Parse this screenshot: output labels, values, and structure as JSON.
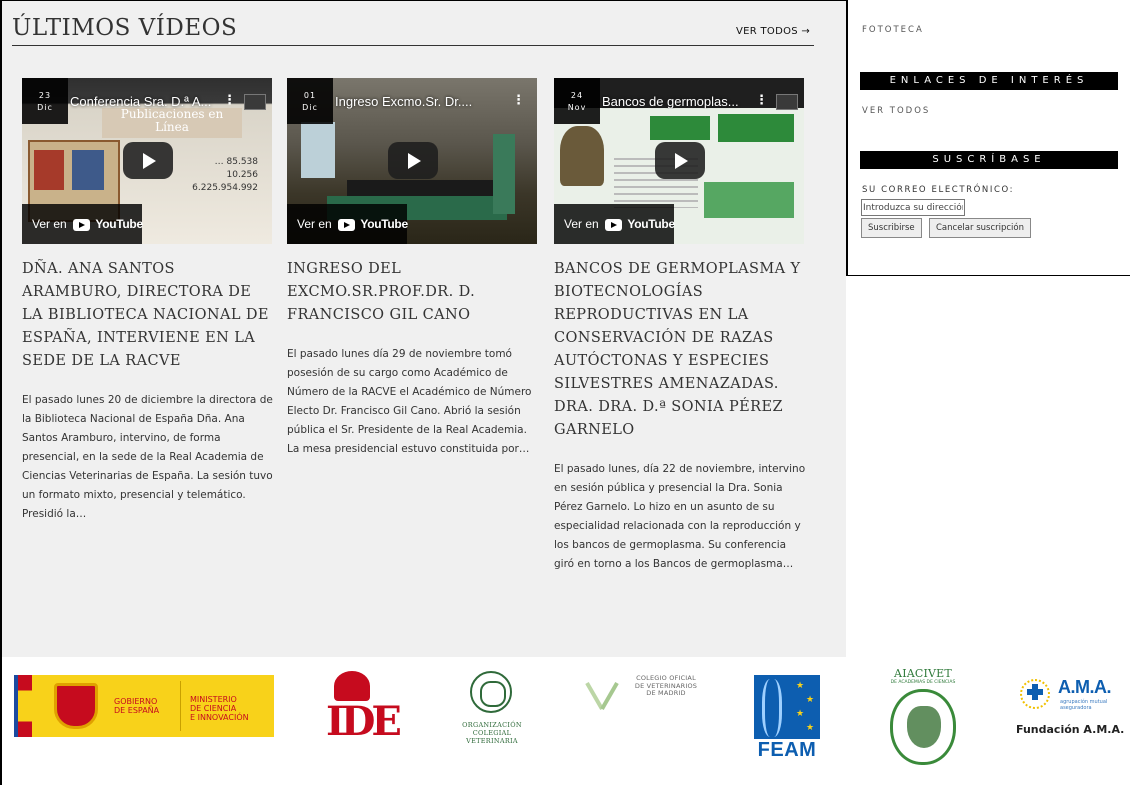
{
  "main": {
    "section_title": "ÚLTIMOS VÍDEOS",
    "see_all": "VER TODOS →",
    "cards": [
      {
        "date_day": "23",
        "date_month": "Dic",
        "video_title": "Conferencia Sra. D.ª A...",
        "yt_watch": "Ver en",
        "yt_brand": "YouTube",
        "title": "DÑA. ANA SANTOS ARAMBURO, DIRECTORA DE LA BIBLIOTECA NACIONAL DE ESPAÑA, INTERVIENE EN LA SEDE DE LA RACVE",
        "excerpt": "El pasado lunes 20 de diciembre la directora de la Biblioteca Nacional de España Dña. Ana Santos Aramburo, intervino, de forma presencial, en la sede de la Real Academia de Ciencias Veterinarias de España. La sesión tuvo un formato mixto, presencial y telemático. Presidió la…",
        "thumb_heading": "Publicaciones en Línea",
        "thumb_numbers": [
          "… 85.538",
          "10.256",
          "6.225.954.992"
        ]
      },
      {
        "date_day": "01",
        "date_month": "Dic",
        "video_title": "Ingreso Excmo.Sr. Dr....",
        "yt_watch": "Ver en",
        "yt_brand": "YouTube",
        "title": "INGRESO DEL EXCMO.SR.PROF.DR. D. FRANCISCO GIL CANO",
        "excerpt": "El pasado lunes día 29 de noviembre tomó posesión de su cargo como Académico de Número de la RACVE el Académico de Número Electo Dr. Francisco Gil Cano. Abrió la sesión pública el Sr. Presidente de la Real Academia. La mesa presidencial estuvo constituida por…"
      },
      {
        "date_day": "24",
        "date_month": "Nov",
        "video_title": "Bancos de germoplas...",
        "yt_watch": "Ver en",
        "yt_brand": "YouTube",
        "title": "BANCOS DE GERMOPLASMA Y BIOTECNOLOGÍAS REPRODUCTIVAS EN LA CONSERVACIÓN DE RAZAS AUTÓCTONAS Y ESPECIES SILVESTRES AMENAZADAS. DRA. DRA. D.ª SONIA PÉREZ GARNELO",
        "excerpt": "El pasado lunes, día 22 de noviembre, intervino en sesión pública y presencial la Dra. Sonia Pérez Garnelo. Lo hizo en un asunto de su especialidad relacionada con la reproducción y los bancos de germoplasma. Su conferencia giró en torno a los Bancos de germoplasma…"
      }
    ]
  },
  "sidebar": {
    "fototeca": "FOTOTECA",
    "links_heading": "ENLACES DE INTERÉS",
    "links_see_all": "VER TODOS",
    "subscribe_heading": "SUSCRÍBASE",
    "email_label": "SU CORREO ELECTRÓNICO:",
    "email_placeholder": "Introduzca su dirección",
    "subscribe_button": "Suscribirse",
    "cancel_button": "Cancelar suscripción"
  },
  "footer": {
    "gobierno": "GOBIERNO\nDE ESPAÑA",
    "ministerio": "MINISTERIO\nDE CIENCIA\nE INNOVACIÓN",
    "ipe": "IDE",
    "ocv": "ORGANIZACIÓN\nCOLEGIAL\nVETERINARIA",
    "cov": "COLEGIO OFICIAL\nDE VETERINARIOS\nDE MADRID",
    "feam": "FEAM",
    "aiacivet": "AIACIVET",
    "aiacivet_sub": "DE ACADEMIAS DE CIENCIAS",
    "ama": "A.M.A.",
    "ama_sub": "agrupación mutual aseguradora",
    "fundacion": "Fundación A.M.A."
  },
  "colors": {
    "accent_black": "#000000",
    "main_bg": "#f0f0f0",
    "gov_yellow": "#f8d21a",
    "red": "#c60b1e",
    "blue": "#0d5eb0",
    "green": "#2f7a3a"
  }
}
